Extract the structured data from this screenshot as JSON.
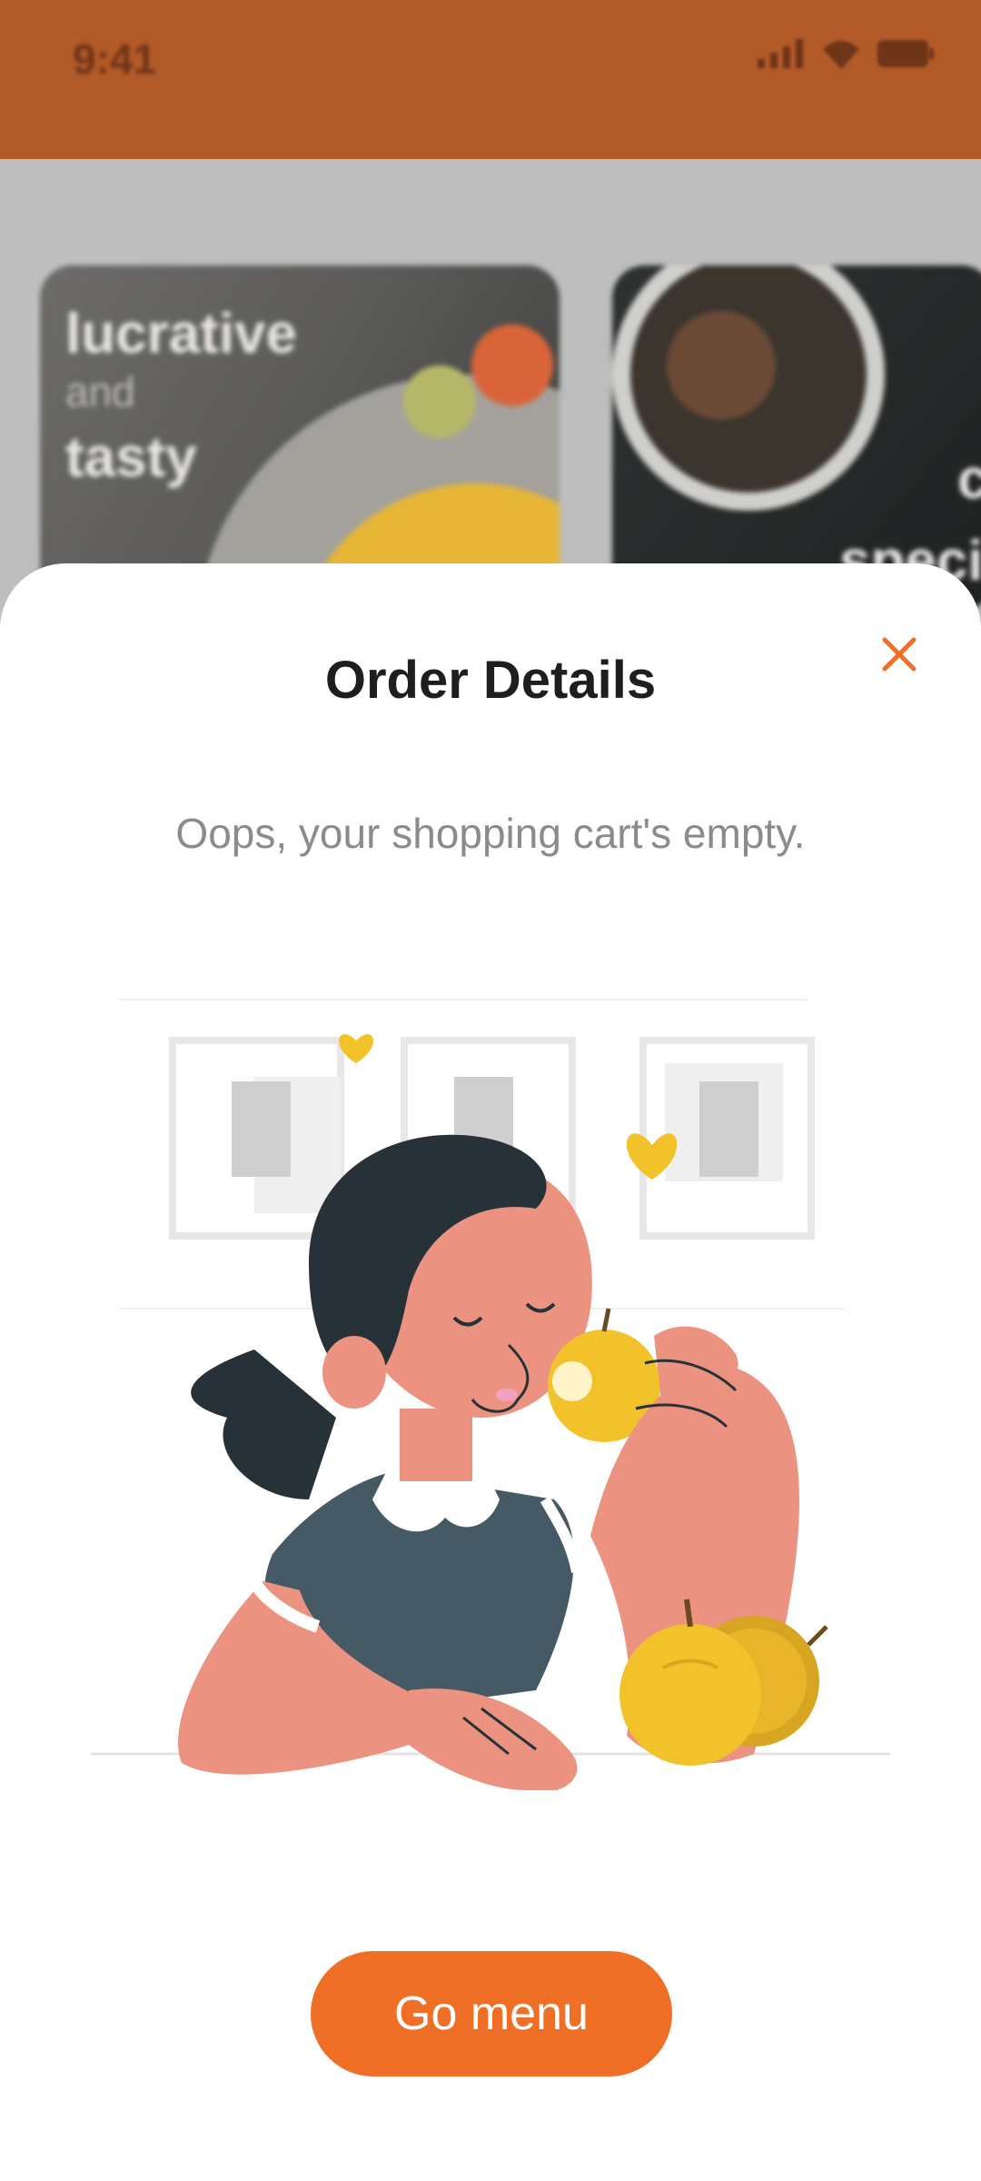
{
  "status_bar": {
    "time": "9:41",
    "icons": [
      "signal-icon",
      "wifi-icon",
      "battery-icon"
    ]
  },
  "background": {
    "banner_1": {
      "line1": "lucrative",
      "line2": "and",
      "line3": "tasty"
    },
    "banner_2": {
      "line1": "c",
      "line2": "speci"
    }
  },
  "sheet": {
    "title": "Order Details",
    "close_icon": "close-icon",
    "message": "Oops, your shopping cart's empty.",
    "illustration": "girl-eating-apple-illustration",
    "cta_label": "Go menu"
  },
  "colors": {
    "status_bar": "#b35a29",
    "accent": "#ee6f25",
    "title": "#1e1e1e",
    "message": "#8b8b8b",
    "apple": "#f2c22b",
    "skin": "#ec9280",
    "hair": "#263238",
    "shirt": "#455a64"
  }
}
